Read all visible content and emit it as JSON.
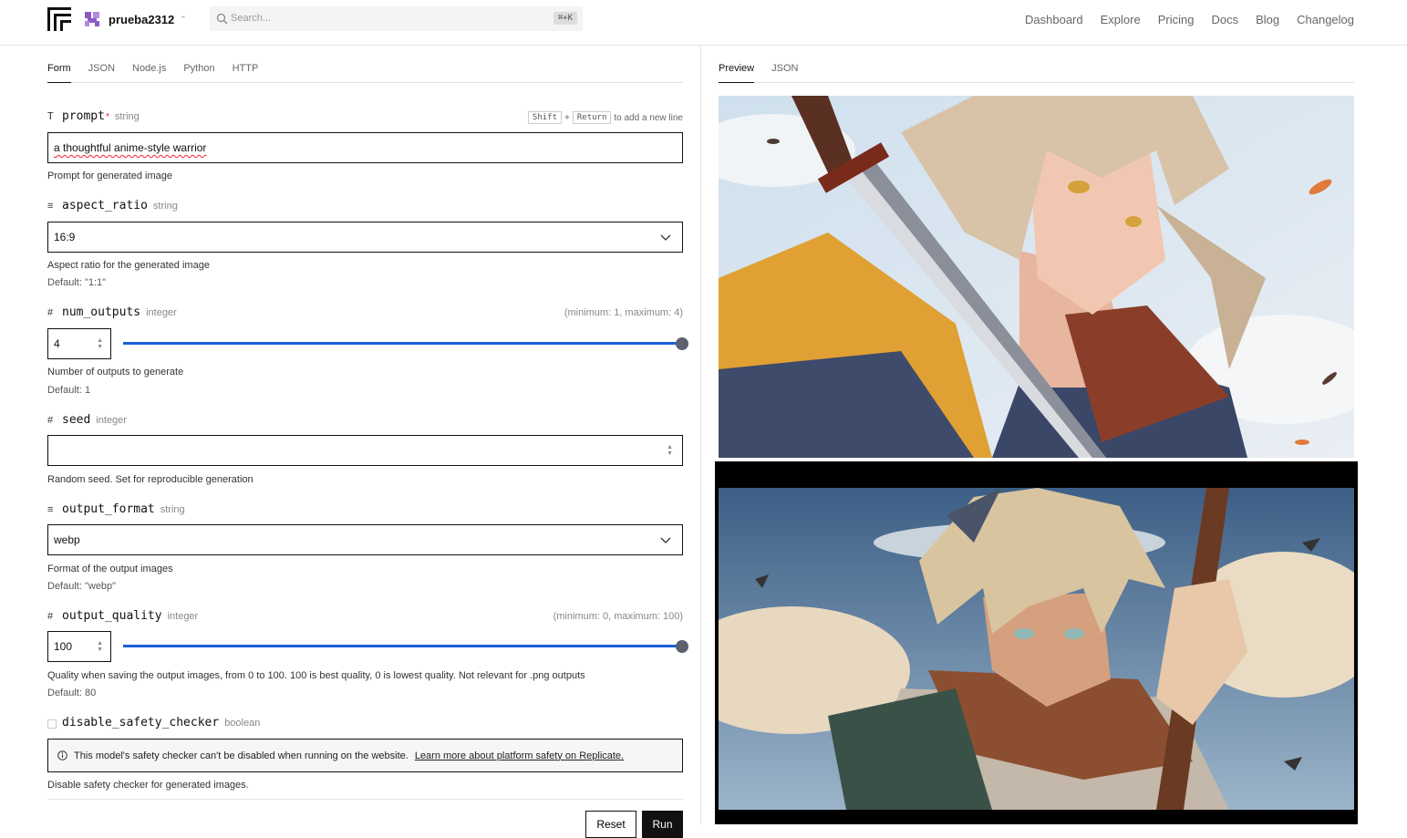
{
  "header": {
    "org_name": "prueba2312",
    "search_placeholder": "Search...",
    "search_shortcut": "⌘+K",
    "nav": [
      "Dashboard",
      "Explore",
      "Pricing",
      "Docs",
      "Blog",
      "Changelog"
    ]
  },
  "input_tabs": [
    {
      "label": "Form",
      "active": true
    },
    {
      "label": "JSON",
      "active": false
    },
    {
      "label": "Node.js",
      "active": false
    },
    {
      "label": "Python",
      "active": false
    },
    {
      "label": "HTTP",
      "active": false
    }
  ],
  "output_tabs": [
    {
      "label": "Preview",
      "active": true
    },
    {
      "label": "JSON",
      "active": false
    }
  ],
  "form": {
    "prompt": {
      "type_icon": "T",
      "name": "prompt",
      "required_mark": "*",
      "type": "string",
      "hint_key1": "Shift",
      "hint_plus": "+",
      "hint_key2": "Return",
      "hint_text": "to add a new line",
      "value": "a thoughtful anime-style warrior",
      "description": "Prompt for generated image"
    },
    "aspect_ratio": {
      "type_icon": "≡",
      "name": "aspect_ratio",
      "type": "string",
      "value": "16:9",
      "description": "Aspect ratio for the generated image",
      "default": "Default: \"1:1\""
    },
    "num_outputs": {
      "type_icon": "#",
      "name": "num_outputs",
      "type": "integer",
      "range": "(minimum: 1, maximum: 4)",
      "value": "4",
      "min": 1,
      "max": 4,
      "slider_value": 4,
      "description": "Number of outputs to generate",
      "default": "Default: 1"
    },
    "seed": {
      "type_icon": "#",
      "name": "seed",
      "type": "integer",
      "value": "",
      "description": "Random seed. Set for reproducible generation"
    },
    "output_format": {
      "type_icon": "≡",
      "name": "output_format",
      "type": "string",
      "value": "webp",
      "description": "Format of the output images",
      "default": "Default: \"webp\""
    },
    "output_quality": {
      "type_icon": "#",
      "name": "output_quality",
      "type": "integer",
      "range": "(minimum: 0, maximum: 100)",
      "value": "100",
      "min": 0,
      "max": 100,
      "slider_value": 100,
      "description": "Quality when saving the output images, from 0 to 100. 100 is best quality, 0 is lowest quality. Not relevant for .png outputs",
      "default": "Default: 80"
    },
    "disable_safety_checker": {
      "name": "disable_safety_checker",
      "type": "boolean",
      "checked": false,
      "notice": "This model's safety checker can't be disabled when running on the website.",
      "notice_link": "Learn more about platform safety on Replicate.",
      "description": "Disable safety checker for generated images."
    }
  },
  "buttons": {
    "reset": "Reset",
    "run": "Run"
  },
  "colors": {
    "accent": "#1a5fd6",
    "slider_thumb": "#5c6070",
    "required": "#e23"
  }
}
